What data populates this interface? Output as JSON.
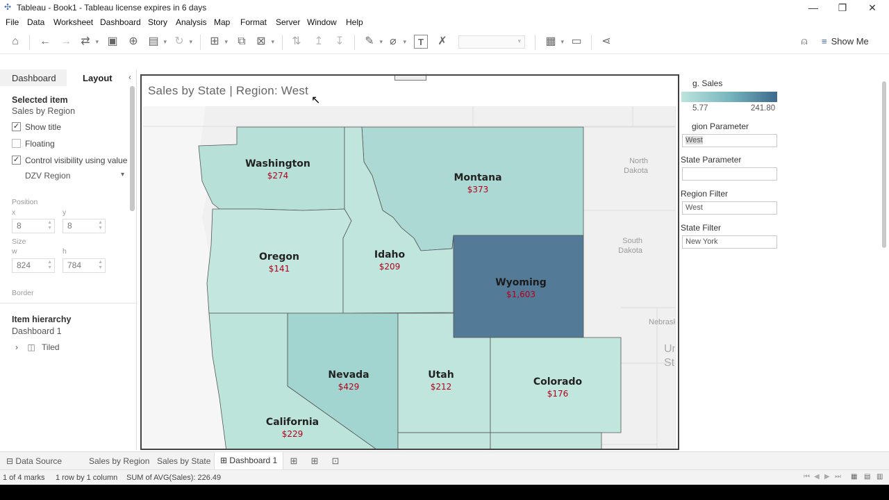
{
  "window": {
    "title": "Tableau - Book1 - Tableau license expires in 6 days",
    "minimize": "—",
    "restore": "❐",
    "close": "✕"
  },
  "menu": [
    "File",
    "Data",
    "Worksheet",
    "Dashboard",
    "Story",
    "Analysis",
    "Map",
    "Format",
    "Server",
    "Window",
    "Help"
  ],
  "toolbar": {
    "show_me": "Show Me"
  },
  "left_panel": {
    "tabs": {
      "dashboard": "Dashboard",
      "layout": "Layout"
    },
    "selected_item_heading": "Selected item",
    "selected_item_value": "Sales by Region",
    "checkboxes": {
      "show_title": {
        "label": "Show title",
        "checked": true
      },
      "floating": {
        "label": "Floating",
        "checked": false
      },
      "control_visibility": {
        "label": "Control visibility using value",
        "checked": true
      }
    },
    "visibility_field": "DZV Region",
    "position_label": "Position",
    "x_label": "x",
    "y_label": "y",
    "x_value": "8",
    "y_value": "8",
    "size_label": "Size",
    "w_label": "w",
    "h_label": "h",
    "w_value": "824",
    "h_value": "784",
    "border_label": "Border",
    "item_hierarchy_heading": "Item hierarchy",
    "hierarchy_root": "Dashboard 1",
    "hierarchy_child": "Tiled"
  },
  "dashboard": {
    "title": "Sales by State | Region: West",
    "states": [
      {
        "name": "Washington",
        "value": "$274",
        "color": "#b7e0d8"
      },
      {
        "name": "Montana",
        "value": "$373",
        "color": "#acd9d4"
      },
      {
        "name": "Oregon",
        "value": "$141",
        "color": "#c3e7de"
      },
      {
        "name": "Idaho",
        "value": "$209",
        "color": "#bfe5dc"
      },
      {
        "name": "Wyoming",
        "value": "$1,603",
        "color": "#537a97"
      },
      {
        "name": "Nevada",
        "value": "$429",
        "color": "#a2d4d0"
      },
      {
        "name": "Utah",
        "value": "$212",
        "color": "#bfe5dc"
      },
      {
        "name": "Colorado",
        "value": "$176",
        "color": "#c1e6dd"
      },
      {
        "name": "California",
        "value": "$229",
        "color": "#bde4db"
      }
    ],
    "background_labels": [
      "North Dakota",
      "South Dakota",
      "Nebrask",
      "Un",
      "St"
    ]
  },
  "right_panel": {
    "legend_title": "g. Sales",
    "legend_min": "5.77",
    "legend_max": "241.80",
    "region_parameter_label": "gion Parameter",
    "region_parameter_value": "West",
    "state_parameter_label": "State Parameter",
    "state_parameter_value": "",
    "region_filter_label": "Region Filter",
    "region_filter_value": "West",
    "state_filter_label": "State Filter",
    "state_filter_value": "New York"
  },
  "sheet_tabs": {
    "data_source": "Data Source",
    "tabs": [
      "Sales by Region",
      "Sales by State",
      "Dashboard 1"
    ],
    "active": "Dashboard 1"
  },
  "status": {
    "marks": "1 of 4 marks",
    "rows_cols": "1 row by 1 column",
    "sum": "SUM of AVG(Sales): 226.49"
  },
  "colors": {
    "value_label": "#b3001b",
    "accent": "#3568b2"
  }
}
